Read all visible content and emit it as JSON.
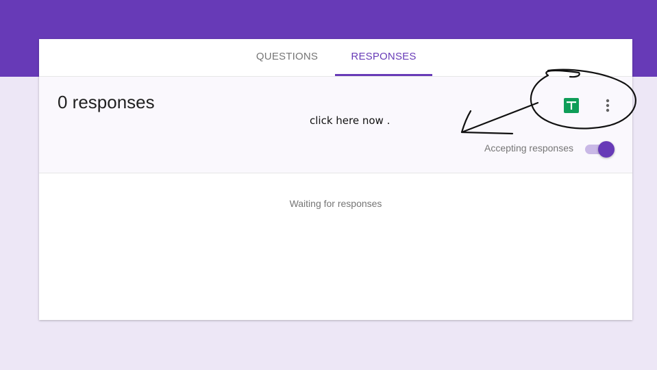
{
  "tabs": [
    {
      "label": "QUESTIONS",
      "active": false
    },
    {
      "label": "RESPONSES",
      "active": true
    }
  ],
  "summary": {
    "count_text": "0 responses",
    "sheets_icon": "google-sheets-icon",
    "more_icon": "more-vert-icon",
    "accepting_label": "Accepting responses",
    "accepting_enabled": true
  },
  "body": {
    "waiting_text": "Waiting for responses"
  },
  "annotation": {
    "text": "click here now ."
  },
  "colors": {
    "accent": "#673ab7",
    "background": "#ede7f6",
    "sheets_green": "#0f9d58"
  }
}
